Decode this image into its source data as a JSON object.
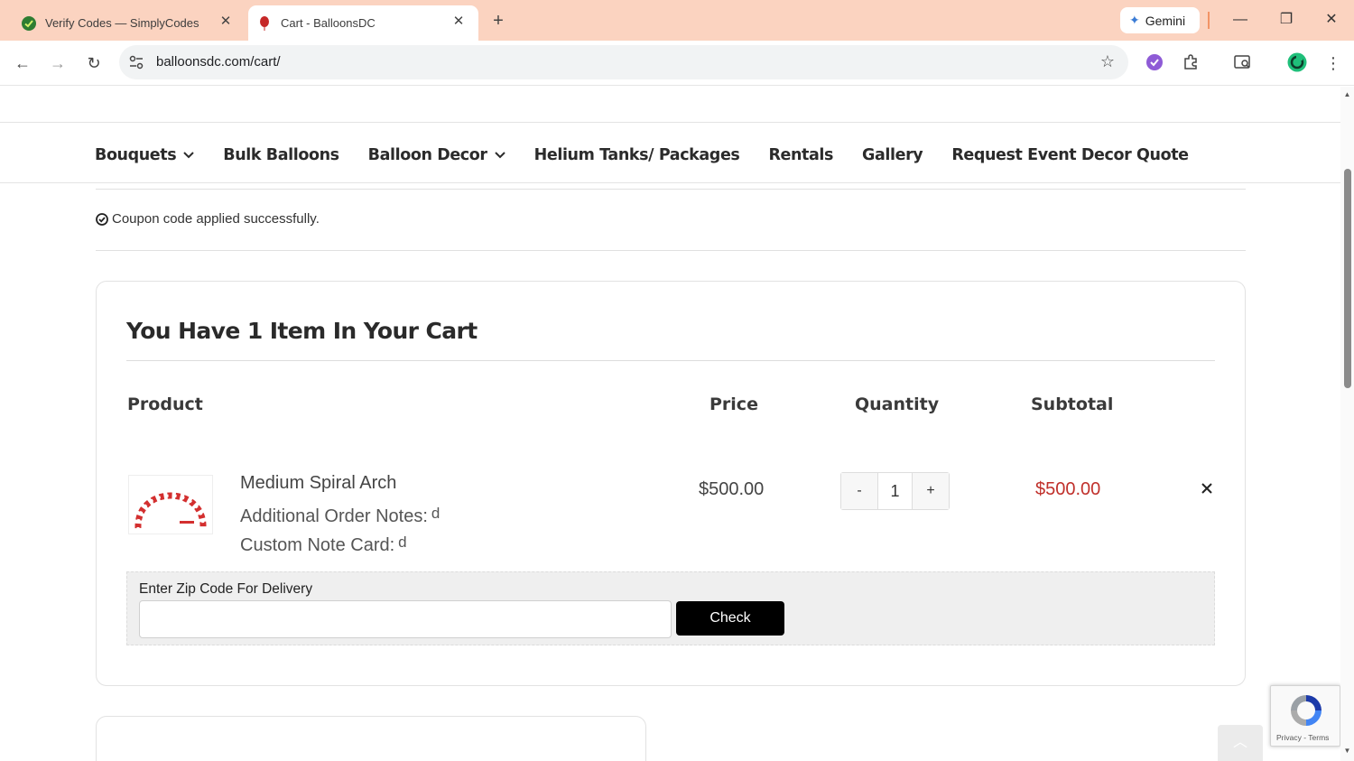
{
  "browser": {
    "tabs": [
      {
        "title": "Verify Codes — SimplyCodes",
        "active": false
      },
      {
        "title": "Cart - BalloonsDC",
        "active": true
      }
    ],
    "gemini_label": "Gemini",
    "url": "balloonsdc.com/cart/"
  },
  "nav": {
    "items": [
      {
        "label": "Bouquets",
        "dropdown": true
      },
      {
        "label": "Bulk Balloons",
        "dropdown": false
      },
      {
        "label": "Balloon Decor",
        "dropdown": true
      },
      {
        "label": "Helium Tanks/ Packages",
        "dropdown": false
      },
      {
        "label": "Rentals",
        "dropdown": false
      },
      {
        "label": "Gallery",
        "dropdown": false
      },
      {
        "label": "Request Event Decor Quote",
        "dropdown": false
      }
    ]
  },
  "notice": {
    "text": "Coupon code applied successfully."
  },
  "cart": {
    "heading": "You Have 1 Item In Your Cart",
    "columns": {
      "product": "Product",
      "price": "Price",
      "quantity": "Quantity",
      "subtotal": "Subtotal"
    },
    "item": {
      "name": "Medium Spiral Arch",
      "notes_label": "Additional Order Notes:",
      "notes_value": "d",
      "card_label": "Custom Note Card:",
      "card_value": "d",
      "price": "$500.00",
      "quantity": "1",
      "minus": "-",
      "plus": "+",
      "subtotal": "$500.00"
    },
    "zip": {
      "label": "Enter Zip Code For Delivery",
      "placeholder": "",
      "button": "Check"
    }
  },
  "recaptcha": {
    "terms": "Privacy - Terms"
  },
  "colors": {
    "tabbar": "#fbd3c0",
    "subtotal": "#c0302b",
    "check_button": "#000000"
  }
}
